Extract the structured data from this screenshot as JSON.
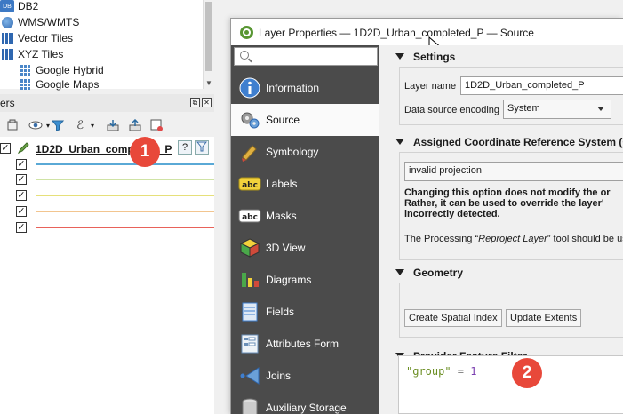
{
  "browser": {
    "items": [
      {
        "label": "DB2",
        "icon": "db2-icon"
      },
      {
        "label": "WMS/WMTS",
        "icon": "globe-icon"
      },
      {
        "label": "Vector Tiles",
        "icon": "vector-tiles-icon"
      },
      {
        "label": "XYZ Tiles",
        "icon": "vector-tiles-icon"
      },
      {
        "label": "Google Hybrid",
        "icon": "xyz-grid-icon"
      },
      {
        "label": "Google Maps",
        "icon": "xyz-grid-icon"
      }
    ]
  },
  "layers_panel": {
    "title": "ers",
    "layer": {
      "name": "1D2D_Urban_completed_P",
      "symbols": [
        {
          "checked": "✓",
          "color": "#5aa9d6"
        },
        {
          "checked": "✓",
          "color": "#cfe3a5"
        },
        {
          "checked": "✓",
          "color": "#e6e07a"
        },
        {
          "checked": "✓",
          "color": "#f2c58f"
        },
        {
          "checked": "✓",
          "color": "#e8625a"
        }
      ]
    },
    "layer_checked": "✓"
  },
  "annotations": {
    "badge1": "1",
    "badge2": "2",
    "color": "#e8483a"
  },
  "dialog": {
    "title": "Layer Properties — 1D2D_Urban_completed_P — Source",
    "nav": [
      {
        "label": "Information",
        "icon": "information-icon"
      },
      {
        "label": "Source",
        "icon": "source-icon",
        "active": true
      },
      {
        "label": "Symbology",
        "icon": "symbology-icon"
      },
      {
        "label": "Labels",
        "icon": "labels-icon"
      },
      {
        "label": "Masks",
        "icon": "masks-icon"
      },
      {
        "label": "3D View",
        "icon": "3d-view-icon"
      },
      {
        "label": "Diagrams",
        "icon": "diagrams-icon"
      },
      {
        "label": "Fields",
        "icon": "fields-icon"
      },
      {
        "label": "Attributes Form",
        "icon": "attributes-form-icon"
      },
      {
        "label": "Joins",
        "icon": "joins-icon"
      },
      {
        "label": "Auxiliary Storage",
        "icon": "auxiliary-storage-icon"
      }
    ],
    "settings": {
      "header": "Settings",
      "layer_name_label": "Layer name",
      "layer_name_value": "1D2D_Urban_completed_P",
      "encoding_label": "Data source encoding",
      "encoding_value": "System"
    },
    "crs": {
      "header": "Assigned Coordinate Reference System (C",
      "value": "invalid projection",
      "warning_line1": "Changing this option does not modify the or",
      "warning_line2": "Rather, it can be used to override the layer'",
      "warning_line3": "incorrectly detected.",
      "note_prefix": "The Processing “",
      "note_italic": "Reproject Layer",
      "note_suffix": "” tool should be use"
    },
    "geometry": {
      "header": "Geometry",
      "create_index": "Create Spatial Index",
      "update_extents": "Update Extents"
    },
    "filter": {
      "header": "Provider Feature Filter",
      "expr_field": "\"group\"",
      "expr_op": " = ",
      "expr_value": "1"
    }
  }
}
